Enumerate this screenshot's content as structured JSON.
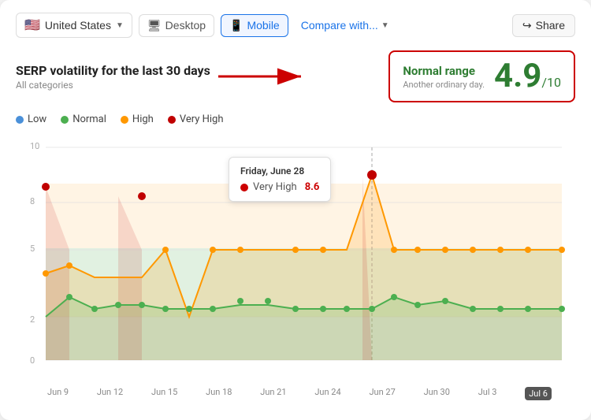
{
  "toolbar": {
    "country": "United States",
    "flag": "🇺🇸",
    "desktop_label": "Desktop",
    "mobile_label": "Mobile",
    "compare_label": "Compare with...",
    "share_label": "Share"
  },
  "header": {
    "title": "SERP volatility for the last 30 days",
    "subtitle": "All categories",
    "score_label": "Normal range",
    "score_sub": "Another ordinary day.",
    "score_value": "4.9",
    "score_denom": "/10"
  },
  "legend": [
    {
      "label": "Low",
      "color": "#4a90d9"
    },
    {
      "label": "Normal",
      "color": "#4caf50"
    },
    {
      "label": "High",
      "color": "#ff9800"
    },
    {
      "label": "Very High",
      "color": "#c00000"
    }
  ],
  "tooltip": {
    "date": "Friday, June 28",
    "label": "Very High",
    "value": "8.6",
    "dot_color": "#c00000"
  },
  "x_labels": [
    "Jun 9",
    "Jun 12",
    "Jun 15",
    "Jun 18",
    "Jun 21",
    "Jun 24",
    "Jun 27",
    "Jun 30",
    "Jul 3",
    "Jul 6"
  ],
  "y_max": 10,
  "y_labels": [
    "0",
    "2",
    "5",
    "10"
  ],
  "colors": {
    "low_fill": "#d0e8f5",
    "normal_fill": "#c8e6c9",
    "high_fill": "#ffe0b2",
    "very_high_fill": "#ffcdd2",
    "green_line": "#4caf50",
    "orange_line": "#ff9800",
    "red_line": "#c00000",
    "blue_fill": "#cde8f7",
    "green_fill": "#d4edda",
    "orange_fill": "#ffe5c7"
  }
}
